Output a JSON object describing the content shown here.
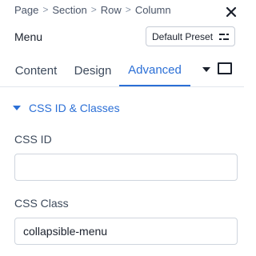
{
  "breadcrumb": {
    "items": [
      "Page",
      "Section",
      "Row",
      "Column"
    ],
    "separator": ">"
  },
  "header": {
    "title": "Menu",
    "preset_label": "Default Preset"
  },
  "tabs": {
    "items": [
      {
        "label": "Content",
        "active": false
      },
      {
        "label": "Design",
        "active": false
      },
      {
        "label": "Advanced",
        "active": true
      }
    ]
  },
  "section": {
    "title": "CSS ID & Classes",
    "expanded": true
  },
  "fields": {
    "css_id": {
      "label": "CSS ID",
      "value": ""
    },
    "css_class": {
      "label": "CSS Class",
      "value": "collapsible-menu"
    }
  },
  "icons": {
    "close": "close-icon",
    "preset": "preset-icon",
    "tab_dropdown": "caret-down-icon",
    "responsive": "desktop-view-icon",
    "section_toggle": "caret-down-icon"
  },
  "colors": {
    "accent": "#2b6fd6",
    "text": "#3d4a5c",
    "border": "#cfd5de"
  }
}
